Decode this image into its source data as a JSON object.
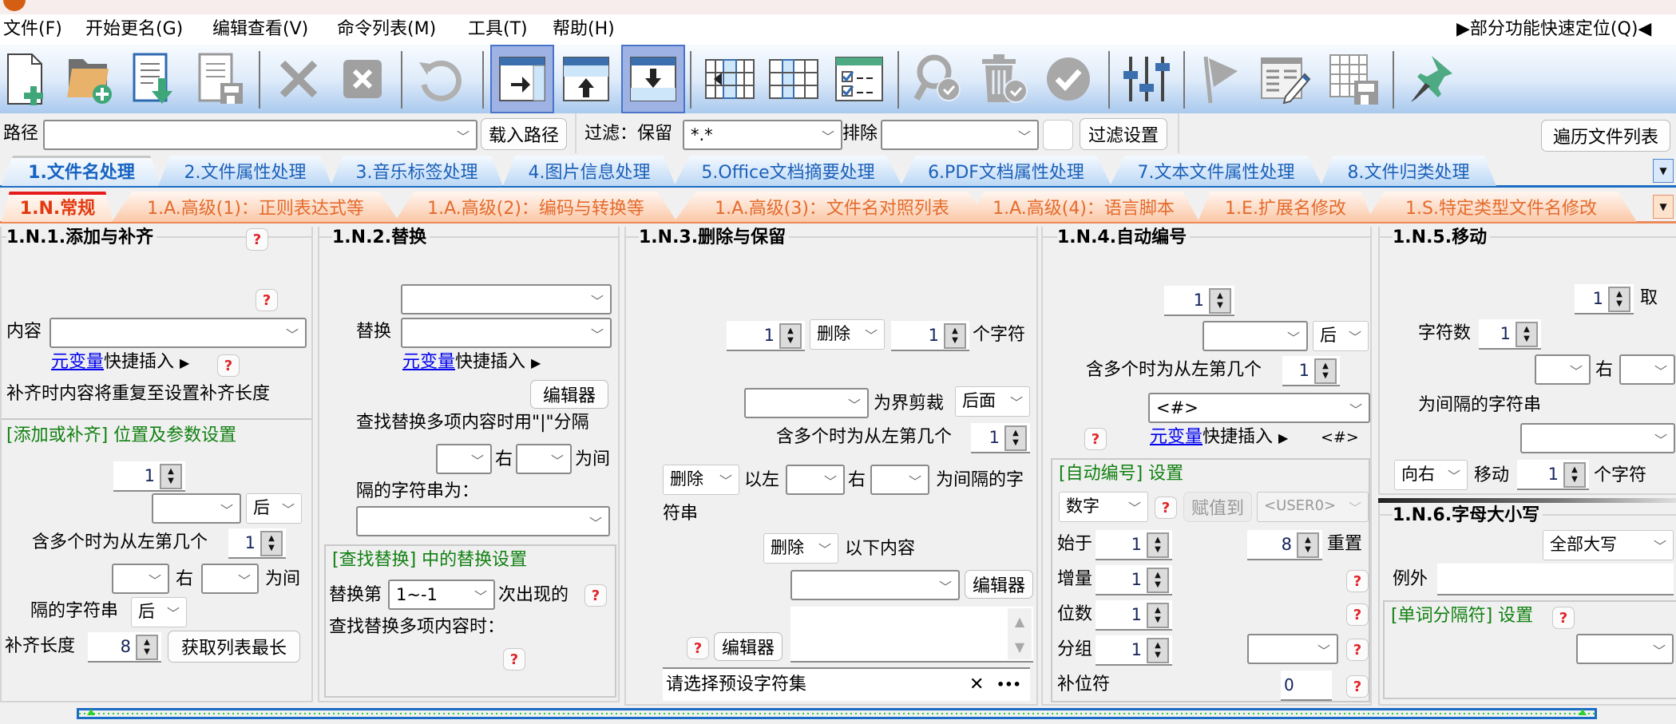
{
  "menu": {
    "items": [
      "文件(F)",
      "开始更名(G)",
      "编辑查看(V)",
      "命令列表(M)",
      "工具(T)",
      "帮助(H)"
    ],
    "quick_locate": "▶部分功能快速定位(Q)◀"
  },
  "toolbar": {
    "icons": [
      "new-file-icon",
      "add-folder-icon",
      "import-list-icon",
      "save-list-icon",
      "delete-icon",
      "clear-icon",
      "undo-icon",
      "move-right-icon",
      "move-up-icon",
      "move-down-icon",
      "column-left-icon",
      "column-icon",
      "checklist-icon",
      "find-check-icon",
      "trash-check-icon",
      "confirm-icon",
      "sliders-icon",
      "flag-icon",
      "edit-table-icon",
      "save-table-icon",
      "pin-icon"
    ]
  },
  "pathrow": {
    "path_label": "路径",
    "path_value": "",
    "load_path_button": "载入路径",
    "filter_label": "过滤：保留",
    "filter_keep_value": "*.*",
    "exclude_label": "排除",
    "exclude_value": "",
    "filter_settings_button": "过滤设置",
    "traverse_button": "遍历文件列表"
  },
  "main_tabs": [
    {
      "label": "1.文件名处理",
      "active": true
    },
    {
      "label": "2.文件属性处理",
      "active": false
    },
    {
      "label": "3.音乐标签处理",
      "active": false
    },
    {
      "label": "4.图片信息处理",
      "active": false
    },
    {
      "label": "5.Office文档摘要处理",
      "active": false
    },
    {
      "label": "6.PDF文档属性处理",
      "active": false
    },
    {
      "label": "7.文本文件属性处理",
      "active": false
    },
    {
      "label": "8.文件归类处理",
      "active": false
    }
  ],
  "sub_tabs": [
    {
      "label": "1.N.常规",
      "active": true
    },
    {
      "label": "1.A.高级(1)：正则表达式等",
      "active": false
    },
    {
      "label": "1.A.高级(2)：编码与转换等",
      "active": false
    },
    {
      "label": "1.A.高级(3)：文件名对照列表",
      "active": false
    },
    {
      "label": "1.A.高级(4)：语言脚本",
      "active": false
    },
    {
      "label": "1.E.扩展名修改",
      "active": false
    },
    {
      "label": "1.S.特定类型文件名修改",
      "active": false
    }
  ],
  "p1": {
    "title": "1.N.1.添加与补齐",
    "content_label": "内容",
    "content_value": "",
    "var_link": "元变量",
    "quick_insert": "快捷插入",
    "note": "补齐时内容将重复至设置补齐长度",
    "group_title": "[添加或补齐] 位置及参数设置",
    "pos_value": "1",
    "after_value": "后",
    "multi_label": "含多个时为从左第几个",
    "multi_value": "1",
    "right_label": "右",
    "between_label": "为间",
    "sep_label": "隔的字符串",
    "sep_after_value": "后",
    "pad_label": "补齐长度",
    "pad_value": "8",
    "get_longest_button": "获取列表最长"
  },
  "p2": {
    "title": "1.N.2.替换",
    "replace_label": "替换",
    "var_link": "元变量",
    "quick_insert": "快捷插入",
    "editor_button": "编辑器",
    "multi_note": "查找替换多项内容时用\"|\"分隔",
    "right_label": "右",
    "between_label": "为间",
    "sep_label": "隔的字符串为：",
    "group_title": "[查找替换] 中的替换设置",
    "replace_nth_label": "替换第",
    "replace_nth_value": "1~-1",
    "occurrence_label": "次出现的",
    "multi_find_label": "查找替换多项内容时："
  },
  "p3": {
    "title": "1.N.3.删除与保留",
    "start_value": "1",
    "action_value": "删除",
    "count_value": "1",
    "chars_label": "个字符",
    "trim_label": "为界剪裁",
    "trim_side_value": "后面",
    "multi_label": "含多个时为从左第几个",
    "multi_value": "1",
    "action2_value": "删除",
    "left_label": "以左",
    "right_label": "右",
    "sep_label": "为间隔的字",
    "sep_label2": "符串",
    "action3_value": "删除",
    "following_label": "以下内容",
    "editor_button": "编辑器",
    "editor_button2": "编辑器",
    "charset_placeholder": "请选择预设字符集",
    "clear_glyph": "✕",
    "more_glyph": "•••"
  },
  "p4": {
    "title": "1.N.4.自动编号",
    "pos_value": "1",
    "after_value": "后",
    "multi_label": "含多个时为从左第几个",
    "multi_value": "1",
    "pattern_value": "<#>",
    "var_link": "元变量",
    "quick_insert": "快捷插入",
    "pattern_hint": "<#>",
    "group_title": "[自动编号] 设置",
    "type_value": "数字",
    "assign_button": "赋值到",
    "assign_target": "<USER0>",
    "start_label": "始于",
    "start_value": "1",
    "reset_value": "8",
    "reset_label": "重置",
    "step_label": "增量",
    "step_value": "1",
    "digits_label": "位数",
    "digits_value": "1",
    "group_label": "分组",
    "group_value": "1",
    "pad_label": "补位符",
    "pad_value": "0"
  },
  "p5": {
    "title": "1.N.5.移动",
    "take_value": "1",
    "take_label": "取",
    "chars_label": "字符数",
    "chars_value": "1",
    "right_label": "右",
    "sep_label": "为间隔的字符串",
    "direction_value": "向右",
    "move_label": "移动",
    "move_value": "1",
    "move_unit": "个字符"
  },
  "p6": {
    "title": "1.N.6.字母大小写",
    "case_value": "全部大写",
    "except_label": "例外",
    "except_value": "",
    "group_title": "[单词分隔符] 设置"
  },
  "help_glyph": "?",
  "spin_up": "▲",
  "spin_down": "▼",
  "combo_arrow": "﹀",
  "triangle_right": "▶",
  "tab_dropdown": "▼"
}
